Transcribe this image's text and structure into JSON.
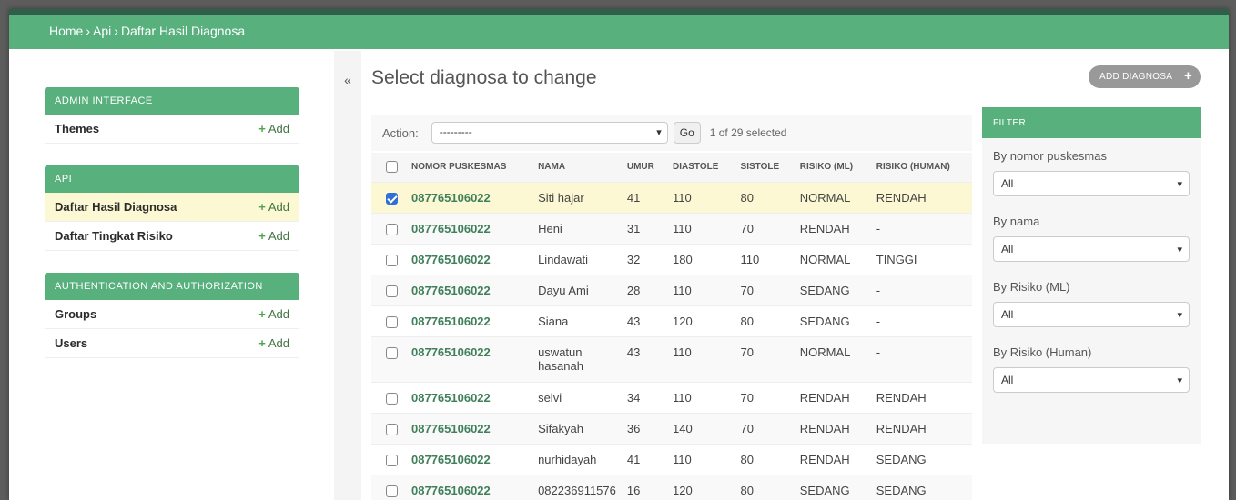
{
  "breadcrumbs": [
    "Home",
    "Api",
    "Daftar Hasil Diagnosa"
  ],
  "breadcrumb_sep": "›",
  "sidebar": {
    "modules": [
      {
        "header": "ADMIN INTERFACE",
        "rows": [
          {
            "label": "Themes",
            "add": "Add"
          }
        ]
      },
      {
        "header": "API",
        "rows": [
          {
            "label": "Daftar Hasil Diagnosa",
            "add": "Add"
          },
          {
            "label": "Daftar Tingkat Risiko",
            "add": "Add"
          }
        ]
      },
      {
        "header": "AUTHENTICATION AND AUTHORIZATION",
        "rows": [
          {
            "label": "Groups",
            "add": "Add"
          },
          {
            "label": "Users",
            "add": "Add"
          }
        ]
      }
    ]
  },
  "collapse_label": "«",
  "page_title": "Select diagnosa to change",
  "add_button": "ADD DIAGNOSA",
  "actions": {
    "label": "Action:",
    "select_value": "---------",
    "go_label": "Go",
    "selected_text": "1 of 29 selected"
  },
  "table": {
    "headers": [
      "NOMOR PUSKESMAS",
      "NAMA",
      "UMUR",
      "DIASTOLE",
      "SISTOLE",
      "RISIKO (ML)",
      "RISIKO (HUMAN)"
    ],
    "rows": [
      {
        "checked": true,
        "cells": [
          "087765106022",
          "Siti hajar",
          "41",
          "110",
          "80",
          "NORMAL",
          "RENDAH"
        ]
      },
      {
        "checked": false,
        "cells": [
          "087765106022",
          "Heni",
          "31",
          "110",
          "70",
          "RENDAH",
          "-"
        ]
      },
      {
        "checked": false,
        "cells": [
          "087765106022",
          "Lindawati",
          "32",
          "180",
          "110",
          "NORMAL",
          "TINGGI"
        ]
      },
      {
        "checked": false,
        "cells": [
          "087765106022",
          "Dayu Ami",
          "28",
          "110",
          "70",
          "SEDANG",
          "-"
        ]
      },
      {
        "checked": false,
        "cells": [
          "087765106022",
          "Siana",
          "43",
          "120",
          "80",
          "SEDANG",
          "-"
        ]
      },
      {
        "checked": false,
        "cells": [
          "087765106022",
          "uswatun hasanah",
          "43",
          "110",
          "70",
          "NORMAL",
          "-"
        ]
      },
      {
        "checked": false,
        "cells": [
          "087765106022",
          "selvi",
          "34",
          "110",
          "70",
          "RENDAH",
          "RENDAH"
        ]
      },
      {
        "checked": false,
        "cells": [
          "087765106022",
          "Sifakyah",
          "36",
          "140",
          "70",
          "RENDAH",
          "RENDAH"
        ]
      },
      {
        "checked": false,
        "cells": [
          "087765106022",
          "nurhidayah",
          "41",
          "110",
          "80",
          "RENDAH",
          "SEDANG"
        ]
      },
      {
        "checked": false,
        "cells": [
          "087765106022",
          "082236911576",
          "16",
          "120",
          "80",
          "SEDANG",
          "SEDANG"
        ]
      }
    ]
  },
  "filter": {
    "header": "FILTER",
    "groups": [
      {
        "label": "By nomor puskesmas",
        "value": "All"
      },
      {
        "label": "By nama",
        "value": "All"
      },
      {
        "label": "By Risiko (ML)",
        "value": "All"
      },
      {
        "label": "By Risiko (Human)",
        "value": "All"
      }
    ]
  },
  "colors": {
    "brand_green": "#58b07d",
    "selected_row": "#fcf8d3",
    "link_green": "#3f7f5a"
  }
}
